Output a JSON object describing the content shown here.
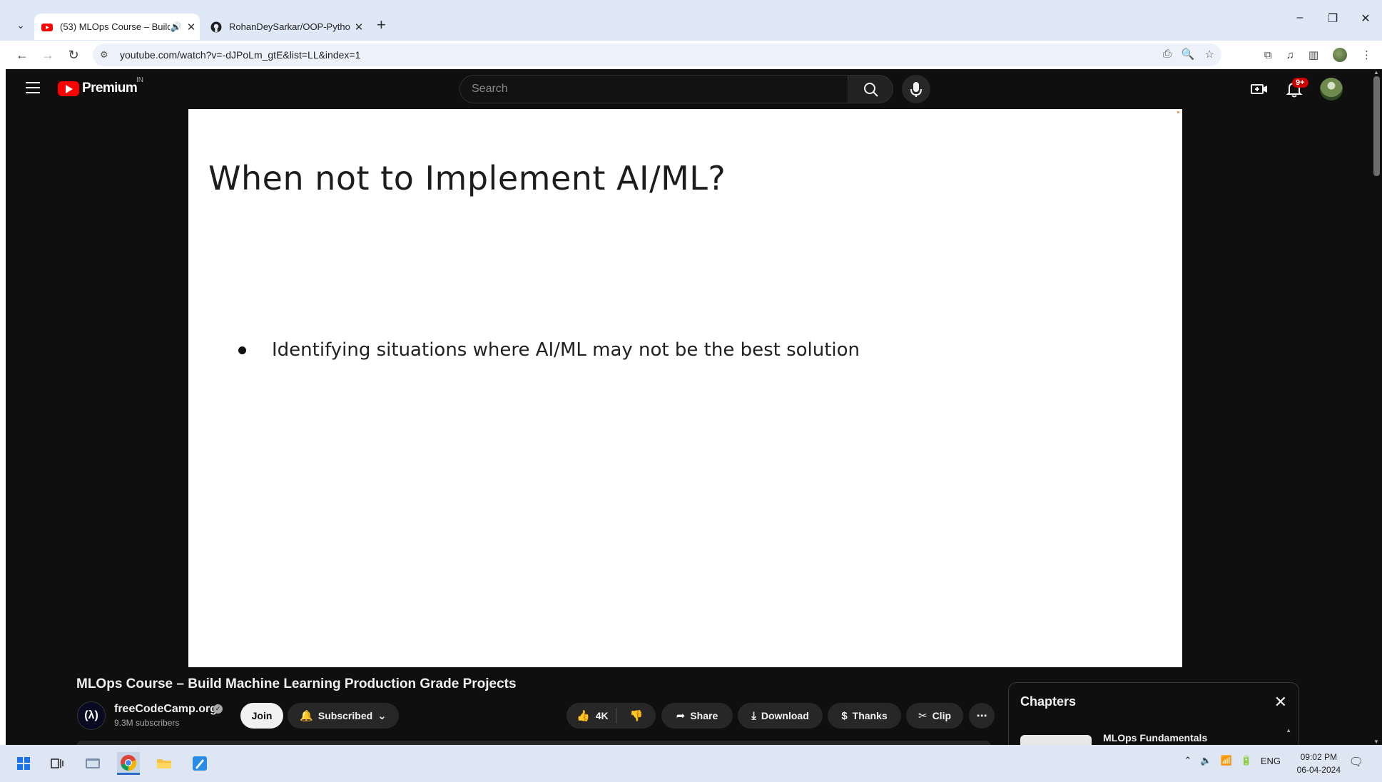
{
  "browser": {
    "tabs": [
      {
        "title": "(53) MLOps Course – Build",
        "active": true
      },
      {
        "title": "RohanDeySarkar/OOP-Python",
        "active": false
      }
    ],
    "url": "youtube.com/watch?v=-dJPoLm_gtE&list=LL&index=1"
  },
  "youtube": {
    "logo_text": "Premium",
    "logo_country": "IN",
    "search_placeholder": "Search",
    "notification_badge": "9+"
  },
  "slide": {
    "title": "When not to Implement AI/ML?",
    "bullets": [
      "Identifying situations where AI/ML may not be the best solution"
    ]
  },
  "video": {
    "title": "MLOps Course – Build Machine Learning Production Grade Projects",
    "channel_name": "freeCodeCamp.org",
    "subscribers": "9.3M subscribers",
    "join_label": "Join",
    "subscribed_label": "Subscribed",
    "likes": "4K",
    "share_label": "Share",
    "download_label": "Download",
    "thanks_label": "Thanks",
    "clip_label": "Clip"
  },
  "chapters": {
    "header": "Chapters",
    "first_chapter": "MLOps Fundamentals"
  },
  "taskbar": {
    "language": "ENG",
    "time": "09:02 PM",
    "date": "06-04-2024"
  },
  "colors": {
    "yt_bg": "#0f0f0f",
    "yt_red": "#ff0000",
    "tab_strip": "#dfe8f7",
    "taskbar": "#dde6f2"
  }
}
